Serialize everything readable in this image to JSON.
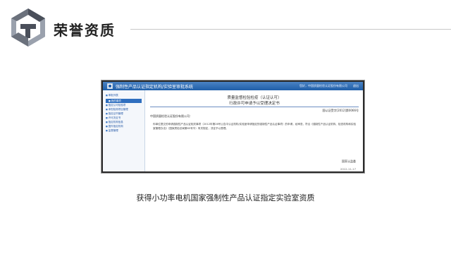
{
  "header": {
    "title": "荣誉资质"
  },
  "window": {
    "app_title": "强制性产品认证指定机构/实验室审批系统",
    "user_info": "您好，中国质量检验认证股份有限公司",
    "logout_label": "退出"
  },
  "sidebar": {
    "items": [
      {
        "label": "审批列表"
      },
      {
        "label": "我的事项"
      },
      {
        "label": "指定认可检验项"
      },
      {
        "label": "承担检测项目管理"
      },
      {
        "label": "指定证书管理"
      },
      {
        "label": "许可决定书"
      },
      {
        "label": "指定机构信息"
      },
      {
        "label": "国外指定机构"
      },
      {
        "label": "监督管理"
      }
    ]
  },
  "document": {
    "title": "质量监督检验检疫（认证认可）",
    "subtitle": "行政许可申请予以受理决定书",
    "ref_no": "国认证受字[2012]第0066号",
    "addressee": "中国质量检验认证股份有限公司：",
    "body": "你单位提交的申请强制性产品认证相关事项（2012年第26号公告中认证机构/实验室申请指定的强制性产品认证事项）的申请，经审查，符合《强制性产品认证机构、检查机构和实验室管理办法》（国家质检总局第65号令）有关规定，决定予以受理。",
    "signature": "国家认监委",
    "date": "2012-11-17"
  },
  "caption": "获得小功率电机国家强制性产品认证指定实验室资质",
  "colors": {
    "titlebar": "#1f5ea8",
    "sidebar_active": "#2f6fbf",
    "logo_dark": "#4a4f5a",
    "logo_light": "#9aa1ad"
  }
}
